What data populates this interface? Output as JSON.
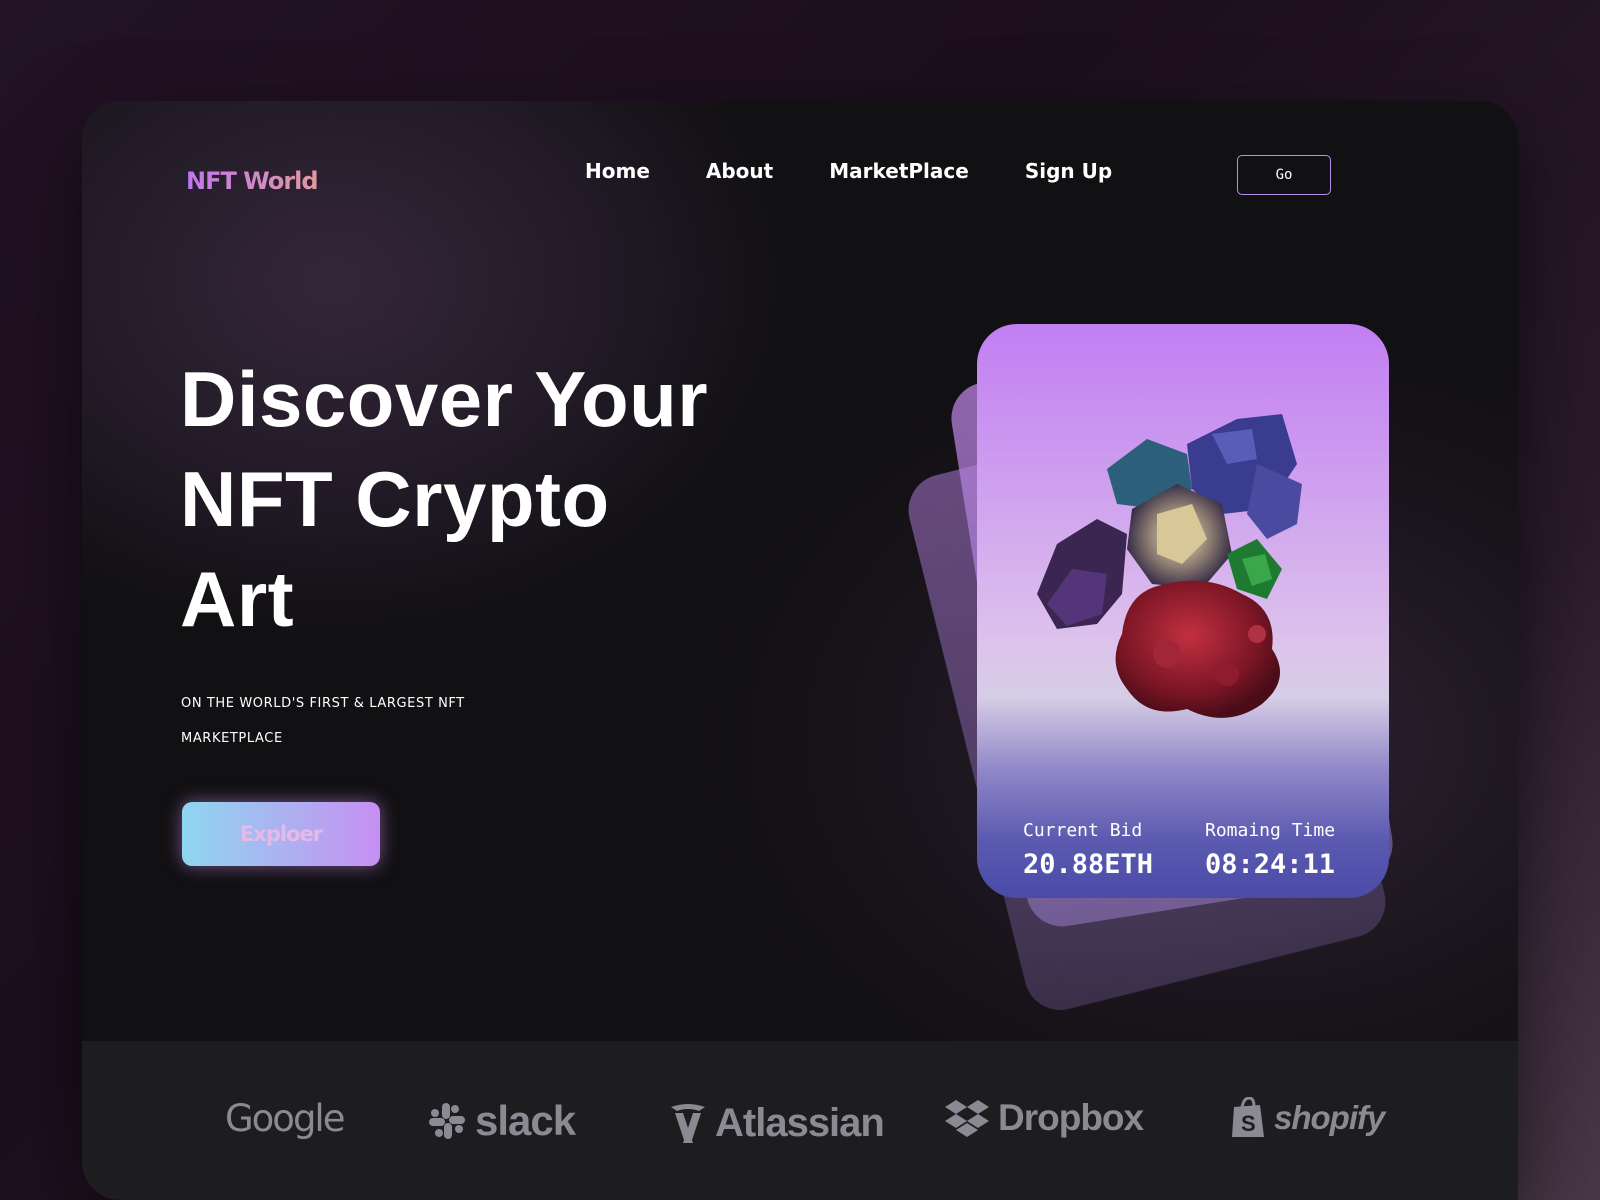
{
  "header": {
    "logo": "NFT World",
    "nav": [
      "Home",
      "About",
      "MarketPlace",
      "Sign Up"
    ],
    "go_label": "Go"
  },
  "hero": {
    "title_lines": [
      "Discover Your",
      "NFT Crypto",
      "Art"
    ],
    "subtitle_lines": [
      "ON THE WORLD'S FIRST & LARGEST NFT",
      "MARKETPLACE"
    ],
    "cta_label": "Exploer"
  },
  "card": {
    "bid_label": "Current Bid",
    "bid_value": "20.88ETH",
    "time_label": "Romaing Time",
    "time_value": "08:24:11"
  },
  "brands": [
    "Google",
    "slack",
    "Atlassian",
    "Dropbox",
    "shopify"
  ],
  "colors": {
    "accent_purple": "#c27ef2",
    "accent_pink": "#e09a9e",
    "button_gradient_start": "#8fd6ef",
    "button_gradient_end": "#c78ff2",
    "brand_gray": "#8a8a92"
  }
}
